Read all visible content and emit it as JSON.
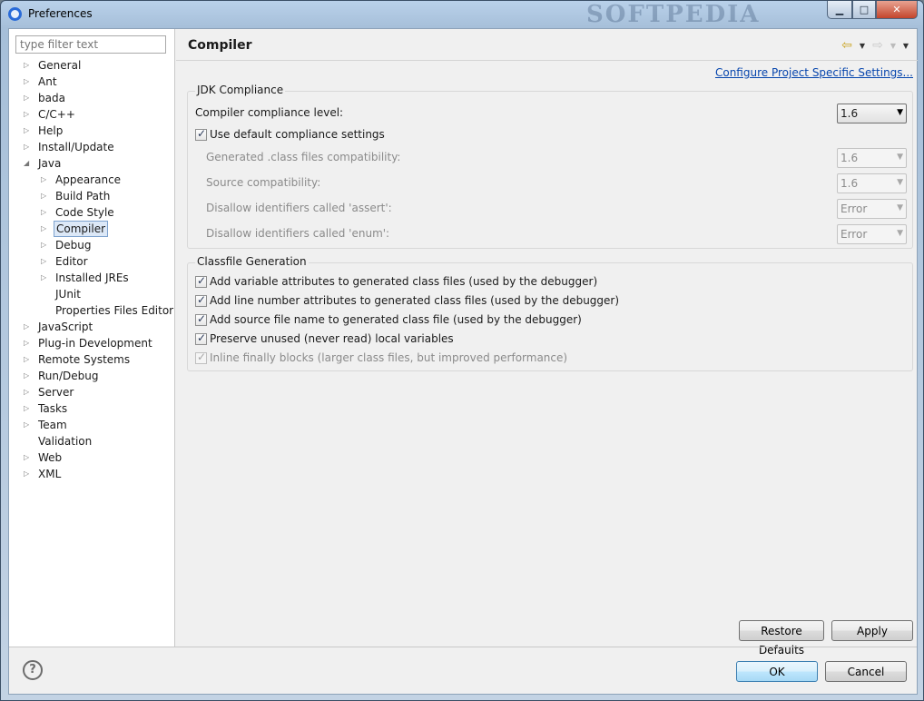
{
  "window": {
    "title": "Preferences",
    "watermark": "SOFTPEDIA",
    "minimize_glyph": "▁",
    "maximize_glyph": "□",
    "close_glyph": "✕"
  },
  "filter": {
    "placeholder": "type filter text"
  },
  "tree": {
    "items": [
      {
        "label": "General",
        "expander": "▷"
      },
      {
        "label": "Ant",
        "expander": "▷"
      },
      {
        "label": "bada",
        "expander": "▷"
      },
      {
        "label": "C/C++",
        "expander": "▷"
      },
      {
        "label": "Help",
        "expander": "▷"
      },
      {
        "label": "Install/Update",
        "expander": "▷"
      },
      {
        "label": "Java",
        "expander": "◢"
      },
      {
        "label": "Appearance",
        "expander": "▷"
      },
      {
        "label": "Build Path",
        "expander": "▷"
      },
      {
        "label": "Code Style",
        "expander": "▷"
      },
      {
        "label": "Compiler",
        "expander": "▷",
        "selected": true
      },
      {
        "label": "Debug",
        "expander": "▷"
      },
      {
        "label": "Editor",
        "expander": "▷"
      },
      {
        "label": "Installed JREs",
        "expander": "▷"
      },
      {
        "label": "JUnit",
        "expander": ""
      },
      {
        "label": "Properties Files Editor",
        "expander": ""
      },
      {
        "label": "JavaScript",
        "expander": "▷"
      },
      {
        "label": "Plug-in Development",
        "expander": "▷"
      },
      {
        "label": "Remote Systems",
        "expander": "▷"
      },
      {
        "label": "Run/Debug",
        "expander": "▷"
      },
      {
        "label": "Server",
        "expander": "▷"
      },
      {
        "label": "Tasks",
        "expander": "▷"
      },
      {
        "label": "Team",
        "expander": "▷"
      },
      {
        "label": "Validation",
        "expander": ""
      },
      {
        "label": "Web",
        "expander": "▷"
      },
      {
        "label": "XML",
        "expander": "▷"
      }
    ]
  },
  "page": {
    "title": "Compiler",
    "nav": {
      "back": "⇦",
      "forward": "⇨",
      "caret": "▼"
    },
    "config_link": "Configure Project Specific Settings..."
  },
  "jdk": {
    "title": "JDK Compliance",
    "compliance_label": "Compiler compliance level:",
    "compliance_value": "1.6",
    "use_default_label": "Use default compliance settings",
    "generated_label": "Generated .class files compatibility:",
    "generated_value": "1.6",
    "source_label": "Source compatibility:",
    "source_value": "1.6",
    "assert_label": "Disallow identifiers called 'assert':",
    "assert_value": "Error",
    "enum_label": "Disallow identifiers called 'enum':",
    "enum_value": "Error",
    "combo_arrow": "▼"
  },
  "classfile": {
    "title": "Classfile Generation",
    "options": [
      "Add variable attributes to generated class files (used by the debugger)",
      "Add line number attributes to generated class files (used by the debugger)",
      "Add source file name to generated class file (used by the debugger)",
      "Preserve unused (never read) local variables",
      "Inline finally blocks (larger class files, but improved performance)"
    ]
  },
  "buttons": {
    "restore_defaults": "Restore Defaults",
    "apply": "Apply",
    "ok": "OK",
    "cancel": "Cancel",
    "help": "?"
  }
}
